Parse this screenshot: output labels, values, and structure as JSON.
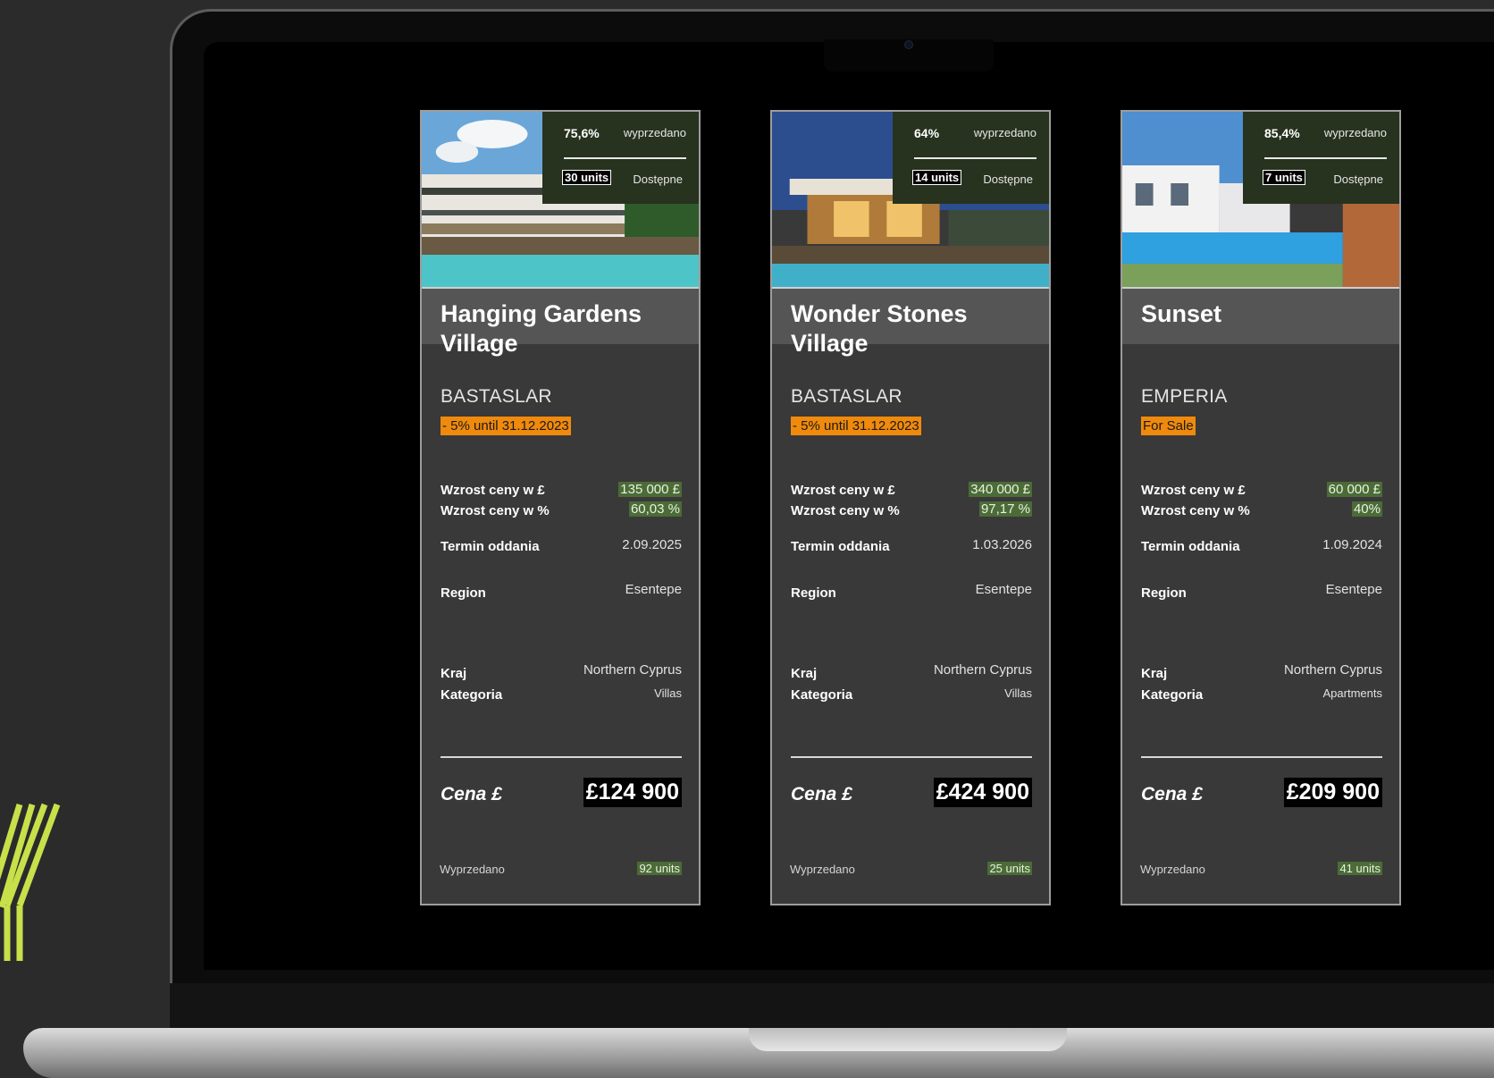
{
  "brand": {
    "accent": "#c8e04a"
  },
  "cards": [
    {
      "sold_pct": "75,6%",
      "sold_pct_label": "wyprzedano",
      "units_available": "30 units",
      "available_label": "Dostępne",
      "title": "Hanging Gardens Village",
      "location": "BASTASLAR",
      "badge": "- 5% until 31.12.2023",
      "price_rise_gbp_label": "Wzrost ceny w £",
      "price_rise_gbp": "135 000 £",
      "price_rise_pct_label": "Wzrost ceny w %",
      "price_rise_pct": "60,03 %",
      "completion_label": "Termin oddania",
      "completion": "2.09.2025",
      "region_label": "Region",
      "region": "Esentepe",
      "country_label": "Kraj",
      "country": "Northern Cyprus",
      "category_label": "Kategoria",
      "category": "Villas",
      "price_label": "Cena £",
      "price": "£124 900",
      "sold_label": "Wyprzedano",
      "sold_units": "92 units"
    },
    {
      "sold_pct": "64%",
      "sold_pct_label": "wyprzedano",
      "units_available": "14 units",
      "available_label": "Dostępne",
      "title": "Wonder Stones Village",
      "location": "BASTASLAR",
      "badge": "- 5% until 31.12.2023",
      "price_rise_gbp_label": "Wzrost ceny w £",
      "price_rise_gbp": "340 000 £",
      "price_rise_pct_label": "Wzrost ceny w %",
      "price_rise_pct": "97,17 %",
      "completion_label": "Termin oddania",
      "completion": "1.03.2026",
      "region_label": "Region",
      "region": "Esentepe",
      "country_label": "Kraj",
      "country": "Northern Cyprus",
      "category_label": "Kategoria",
      "category": "Villas",
      "price_label": "Cena £",
      "price": "£424 900",
      "sold_label": "Wyprzedano",
      "sold_units": "25 units"
    },
    {
      "sold_pct": "85,4%",
      "sold_pct_label": "wyprzedano",
      "units_available": "7 units",
      "available_label": "Dostępne",
      "title": "Sunset",
      "location": "EMPERIA",
      "badge": "For Sale",
      "price_rise_gbp_label": "Wzrost ceny w £",
      "price_rise_gbp": "60 000 £",
      "price_rise_pct_label": "Wzrost ceny w %",
      "price_rise_pct": "40%",
      "completion_label": "Termin oddania",
      "completion": "1.09.2024",
      "region_label": "Region",
      "region": "Esentepe",
      "country_label": "Kraj",
      "country": "Northern Cyprus",
      "category_label": "Kategoria",
      "category": "Apartments",
      "price_label": "Cena £",
      "price": "£209 900",
      "sold_label": "Wyprzedano",
      "sold_units": "41 units"
    }
  ]
}
